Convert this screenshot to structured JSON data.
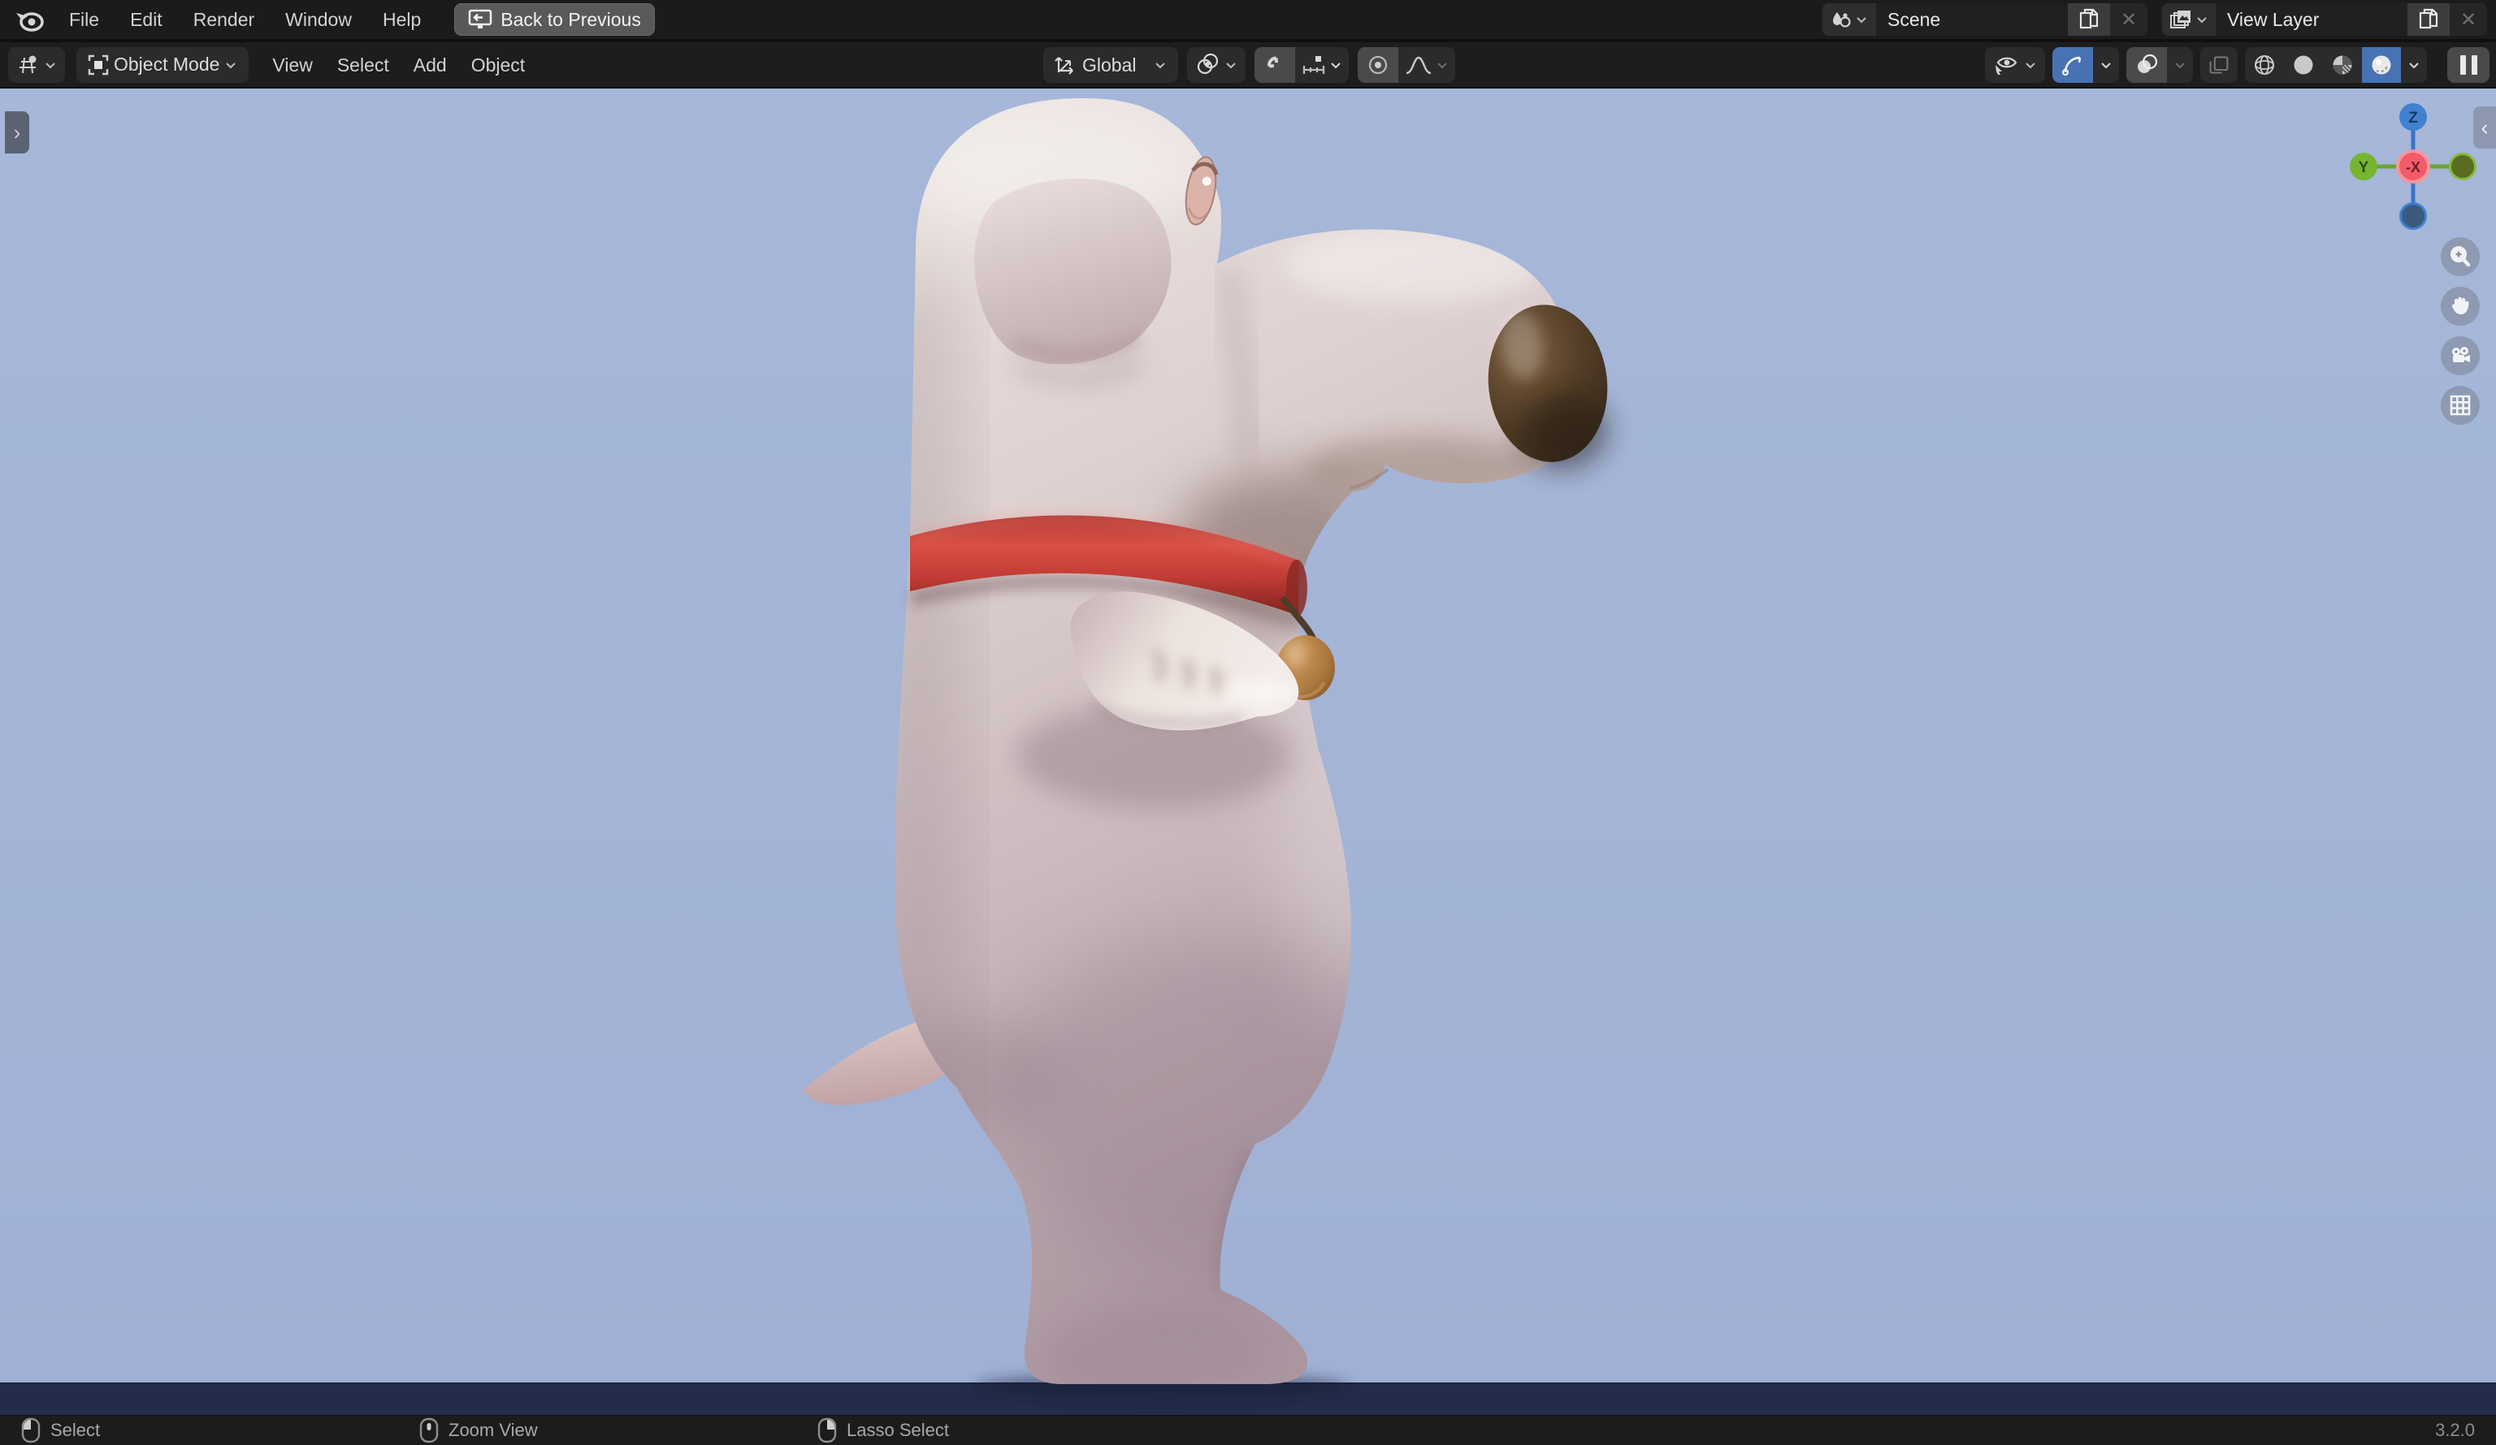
{
  "topbar": {
    "menus": [
      "File",
      "Edit",
      "Render",
      "Window",
      "Help"
    ],
    "back_button": "Back to Previous",
    "scene_selector": {
      "value": "Scene"
    },
    "view_layer_selector": {
      "value": "View Layer"
    }
  },
  "viewport_header": {
    "mode": "Object Mode",
    "menus": [
      "View",
      "Select",
      "Add",
      "Object"
    ],
    "orientation": "Global"
  },
  "viewport": {
    "gizmo": {
      "up": "Z",
      "left": "Y",
      "center": "-X"
    }
  },
  "status_bar": {
    "hints": [
      {
        "icon": "mouse-left-icon",
        "label": "Select"
      },
      {
        "icon": "mouse-middle-icon",
        "label": "Zoom View"
      },
      {
        "icon": "mouse-right-icon",
        "label": "Lasso Select"
      }
    ],
    "version": "3.2.0"
  },
  "colors": {
    "accent_blue": "#4772b3",
    "viewport_bg": "#a4b6d8",
    "floor_navy": "#232c49",
    "collar_red": "#d94f46",
    "axis_z_blue": "#4081d1",
    "axis_y_green": "#76b52f",
    "axis_x_red": "#f25c68"
  }
}
